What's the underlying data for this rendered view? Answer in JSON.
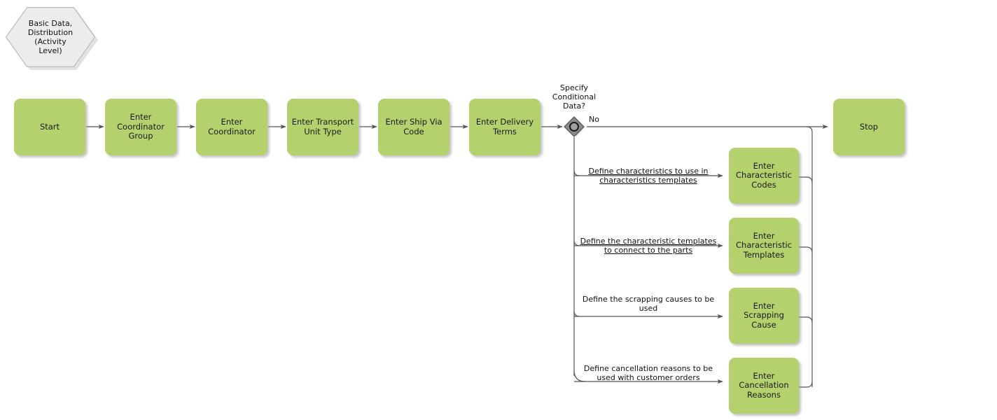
{
  "diagram": {
    "title": "Basic Data, Distribution (Activity Level)",
    "type": "bpmn-process-flow",
    "colors": {
      "activity_fill": "#b5d16e",
      "pool_fill": "#ececec",
      "gateway_fill": "#808080",
      "edge": "#555555",
      "text": "#111111"
    }
  },
  "pool": {
    "label": "Basic Data,\nDistribution\n(Activity\nLevel)"
  },
  "main_flow": [
    {
      "id": "start",
      "label": "Start"
    },
    {
      "id": "coord_group",
      "label": "Enter\nCoordinator\nGroup"
    },
    {
      "id": "coordinator",
      "label": "Enter\nCoordinator"
    },
    {
      "id": "transport_unit",
      "label": "Enter Transport\nUnit Type"
    },
    {
      "id": "ship_via",
      "label": "Enter Ship Via\nCode"
    },
    {
      "id": "delivery_terms",
      "label": "Enter Delivery\nTerms"
    }
  ],
  "gateway": {
    "id": "specify_conditional_data",
    "label": "Specify\nConditional\nData?",
    "no_branch_label": "No"
  },
  "branches": [
    {
      "id": "characteristic_codes",
      "edge_label": "Define characteristics to use in\ncharacteristics templates",
      "edge_label_underlined": true,
      "node_label": "Enter\nCharacteristic\nCodes"
    },
    {
      "id": "characteristic_templates",
      "edge_label": "Define the characteristic templates\nto connect to the parts",
      "edge_label_underlined": true,
      "node_label": "Enter\nCharacteristic\nTemplates"
    },
    {
      "id": "scrapping_cause",
      "edge_label": "Define the scrapping causes to be\nused",
      "edge_label_underlined": false,
      "node_label": "Enter Scrapping\nCause"
    },
    {
      "id": "cancellation_reasons",
      "edge_label": "Define cancellation reasons to be\nused with customer orders",
      "edge_label_underlined": false,
      "node_label": "Enter\nCancellation\nReasons"
    }
  ],
  "end_node": {
    "id": "stop",
    "label": "Stop"
  }
}
